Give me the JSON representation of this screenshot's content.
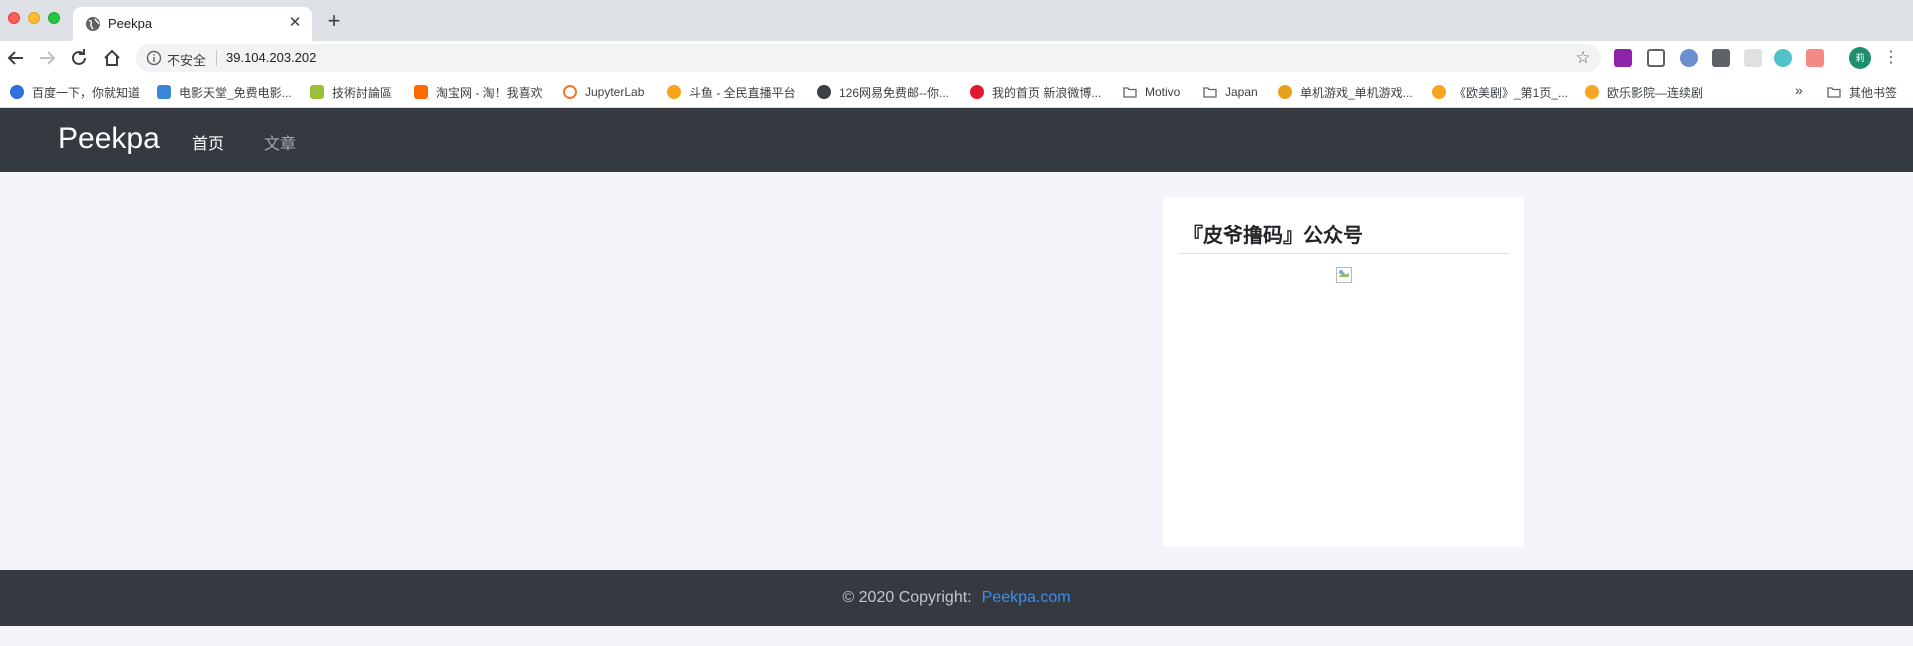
{
  "browser": {
    "tab": {
      "title": "Peekpa"
    },
    "omnibox": {
      "security_label": "不安全",
      "url": "39.104.203.202"
    },
    "profile_initial": "莉",
    "bookmarks": [
      {
        "label": "百度一下，你就知道",
        "color": "#2f6fde"
      },
      {
        "label": "电影天堂_免费电影...",
        "color": "#3a86d8"
      },
      {
        "label": "技術討論區",
        "color": "#9bbf3c"
      },
      {
        "label": "淘宝网 - 淘！我喜欢",
        "color": "#ff6a00"
      },
      {
        "label": "JupyterLab",
        "color": "#f37626"
      },
      {
        "label": "斗鱼 - 全民直播平台",
        "color": "#f7a21b"
      },
      {
        "label": "126网易免费邮--你...",
        "color": "#3c4043"
      },
      {
        "label": "我的首页 新浪微博...",
        "color": "#e6162d"
      },
      {
        "label": "Motivo",
        "color": "folder"
      },
      {
        "label": "Japan",
        "color": "folder"
      },
      {
        "label": "单机游戏_单机游戏...",
        "color": "#e7a11b"
      },
      {
        "label": "《欧美剧》_第1页_...",
        "color": "#f5a623"
      },
      {
        "label": "欧乐影院—连续剧",
        "color": "#f5a623"
      }
    ],
    "bookmarks_more": "»",
    "other_bookmarks": "其他书签"
  },
  "site": {
    "brand": "Peekpa",
    "nav": {
      "home": "首页",
      "articles": "文章"
    },
    "sidebar_card": {
      "title": "『皮爷撸码』公众号"
    },
    "footer": {
      "copyright": "© 2020 Copyright:",
      "link": "Peekpa.com"
    }
  }
}
